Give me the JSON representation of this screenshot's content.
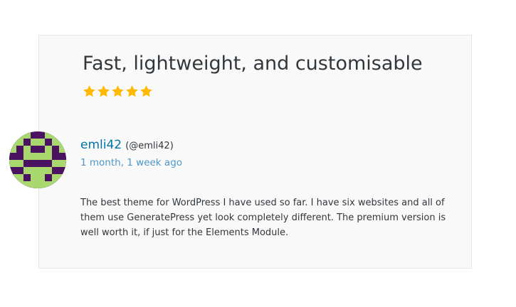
{
  "review": {
    "title": "Fast, lightweight, and customisable",
    "rating": 5,
    "rating_max": 5,
    "author": {
      "name": "emli42",
      "handle": "(@emli42)",
      "avatar_icon": "pixel-identicon-avatar"
    },
    "date": "1 month, 1 week ago",
    "body": "The best theme for WordPress I have used so far. I have six websites and all of them use GeneratePress yet look completely different. The premium version is well worth it, if just for the Elements Module."
  },
  "colors": {
    "star": "#ffb900",
    "link": "#0073aa",
    "date_link": "#4c97c9",
    "avatar_bg": "#4a1260",
    "avatar_fg": "#a8d86e"
  }
}
